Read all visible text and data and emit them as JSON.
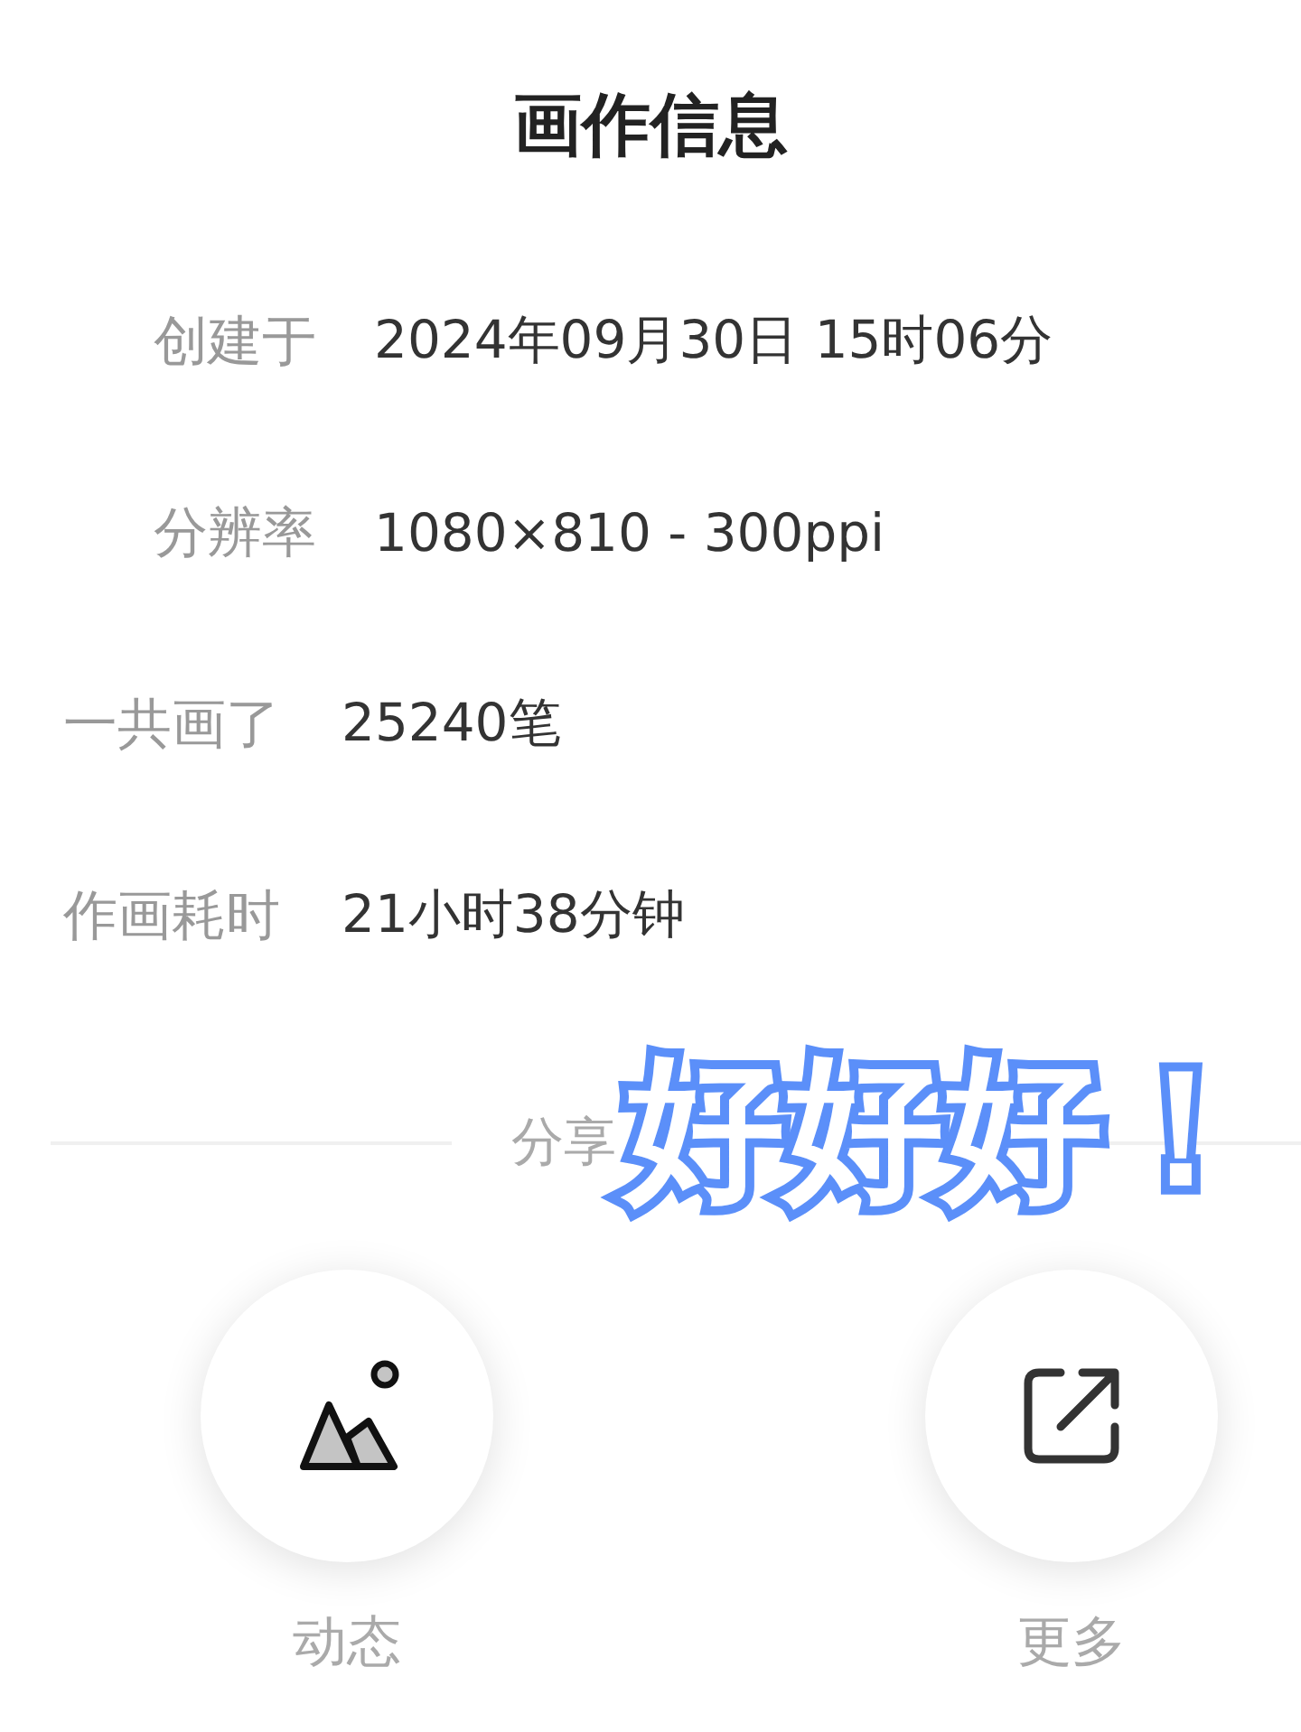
{
  "title": "画作信息",
  "info": [
    {
      "label": "创建于",
      "value": "2024年09月30日 15时06分"
    },
    {
      "label": "分辨率",
      "value": "1080×810 - 300ppi"
    },
    {
      "label": "一共画了",
      "value": "25240笔"
    },
    {
      "label": "作画耗时",
      "value": "21小时38分钟"
    }
  ],
  "share_divider": {
    "label": "分享"
  },
  "actions": [
    {
      "kind": "post",
      "label": "动态"
    },
    {
      "kind": "more",
      "label": "更多"
    }
  ],
  "sticker": {
    "text": "好好好！"
  }
}
